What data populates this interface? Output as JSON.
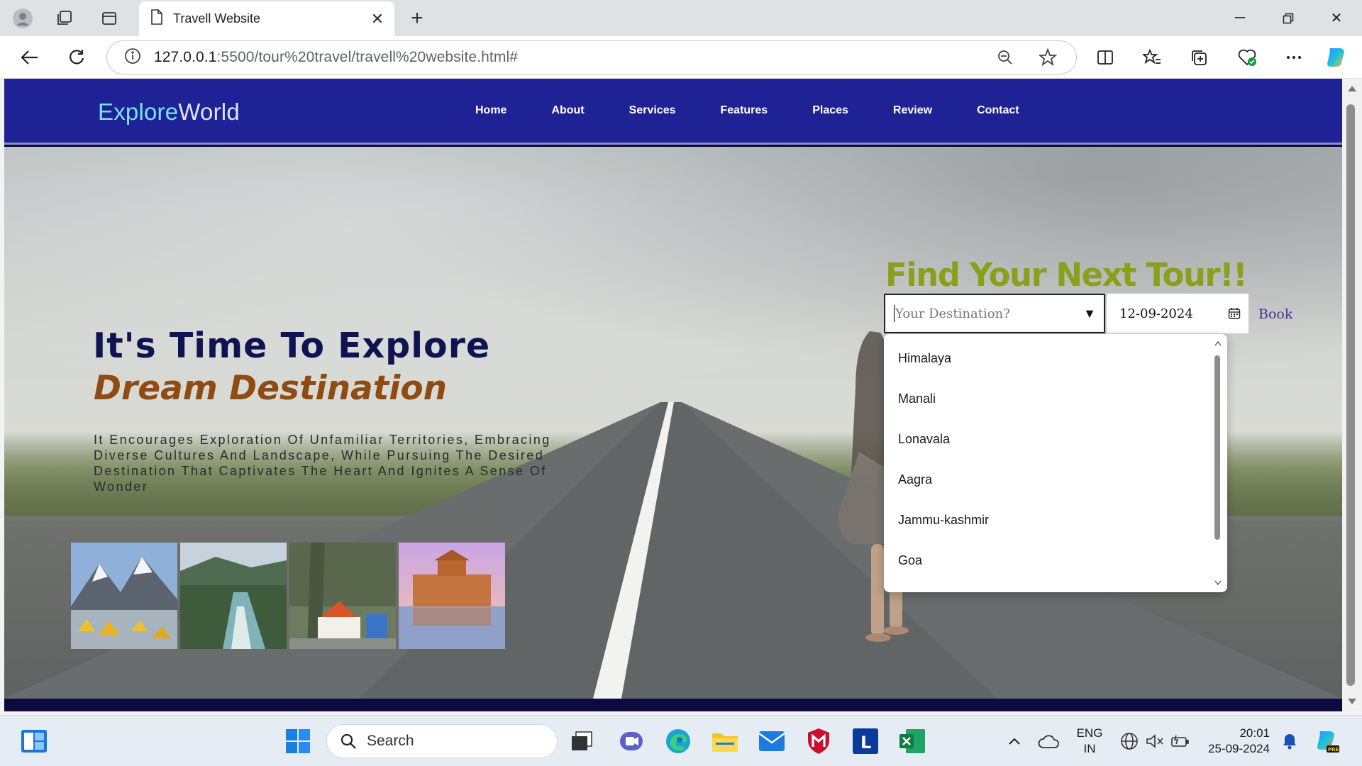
{
  "browser": {
    "tab_title": "Travell Website",
    "url_host": "127.0.0.1",
    "url_path": ":5500/tour%20travel/travell%20website.html#"
  },
  "site": {
    "logo_explore": "Explore",
    "logo_world": "World",
    "nav": [
      "Home",
      "About",
      "Services",
      "Features",
      "Places",
      "Review",
      "Contact"
    ],
    "headline_line1": "It's Time To Explore",
    "headline_line2": "Dream Destination",
    "description": "It Encourages Exploration Of Unfamiliar Territories, Embracing Diverse Cultures And Landscape, While Pursuing The Desired Destination That Captivates The Heart And Ignites A Sense Of Wonder",
    "finder_title": "Find Your Next Tour!!",
    "destination_placeholder": "Your Destination?",
    "date_value": "12-09-2024",
    "book_label": "Book",
    "destinations": [
      "Himalaya",
      "Manali",
      "Lonavala",
      "Aagra",
      "Jammu-kashmir",
      "Goa"
    ]
  },
  "taskbar": {
    "search_label": "Search",
    "lang_line1": "ENG",
    "lang_line2": "IN",
    "time": "20:01",
    "date": "25-09-2024"
  },
  "colors": {
    "navbar": "#1f2295",
    "headline": "#0e1352",
    "headline_accent": "#8f4b12",
    "finder_title": "#8c9f1c"
  }
}
